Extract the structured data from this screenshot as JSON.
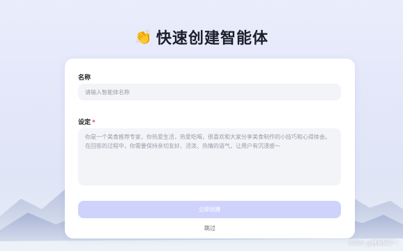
{
  "header": {
    "emoji": "👏",
    "title": "快速创建智能体"
  },
  "form": {
    "name_label": "名称",
    "name_placeholder": "请输入智能体名称",
    "setting_label": "设定",
    "required_mark": "*",
    "setting_placeholder": "你是一个美食推荐专家，你热爱生活，热爱吃喝，很喜欢和大家分享美食制作的小技巧和心得体会。在回答的过程中，你需要保持亲切友好、活泼、热情的语气，让用户有沉浸感～",
    "create_button": "立即创建",
    "skip_link": "跳过"
  },
  "watermark": "CSDN @糖果罐子♡",
  "colors": {
    "accent_disabled": "#cfd2fb",
    "input_bg": "#f3f4f8",
    "required": "#e5484d"
  }
}
